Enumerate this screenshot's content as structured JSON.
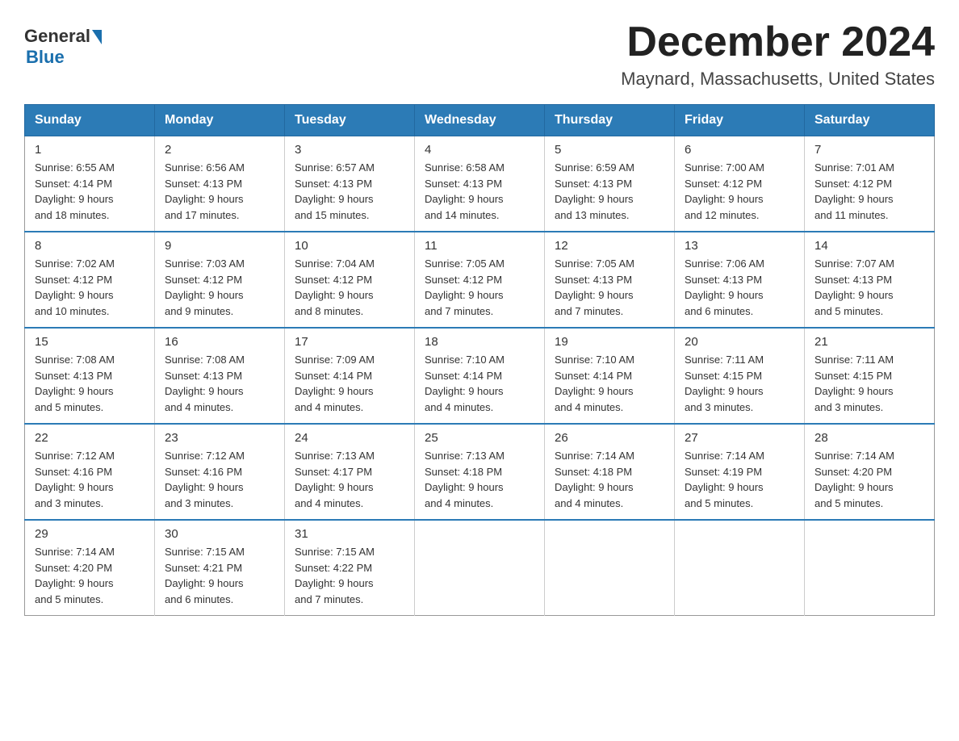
{
  "logo": {
    "general": "General",
    "blue": "Blue"
  },
  "title": {
    "month": "December 2024",
    "location": "Maynard, Massachusetts, United States"
  },
  "weekdays": [
    "Sunday",
    "Monday",
    "Tuesday",
    "Wednesday",
    "Thursday",
    "Friday",
    "Saturday"
  ],
  "weeks": [
    [
      {
        "day": "1",
        "sunrise": "6:55 AM",
        "sunset": "4:14 PM",
        "daylight": "9 hours and 18 minutes."
      },
      {
        "day": "2",
        "sunrise": "6:56 AM",
        "sunset": "4:13 PM",
        "daylight": "9 hours and 17 minutes."
      },
      {
        "day": "3",
        "sunrise": "6:57 AM",
        "sunset": "4:13 PM",
        "daylight": "9 hours and 15 minutes."
      },
      {
        "day": "4",
        "sunrise": "6:58 AM",
        "sunset": "4:13 PM",
        "daylight": "9 hours and 14 minutes."
      },
      {
        "day": "5",
        "sunrise": "6:59 AM",
        "sunset": "4:13 PM",
        "daylight": "9 hours and 13 minutes."
      },
      {
        "day": "6",
        "sunrise": "7:00 AM",
        "sunset": "4:12 PM",
        "daylight": "9 hours and 12 minutes."
      },
      {
        "day": "7",
        "sunrise": "7:01 AM",
        "sunset": "4:12 PM",
        "daylight": "9 hours and 11 minutes."
      }
    ],
    [
      {
        "day": "8",
        "sunrise": "7:02 AM",
        "sunset": "4:12 PM",
        "daylight": "9 hours and 10 minutes."
      },
      {
        "day": "9",
        "sunrise": "7:03 AM",
        "sunset": "4:12 PM",
        "daylight": "9 hours and 9 minutes."
      },
      {
        "day": "10",
        "sunrise": "7:04 AM",
        "sunset": "4:12 PM",
        "daylight": "9 hours and 8 minutes."
      },
      {
        "day": "11",
        "sunrise": "7:05 AM",
        "sunset": "4:12 PM",
        "daylight": "9 hours and 7 minutes."
      },
      {
        "day": "12",
        "sunrise": "7:05 AM",
        "sunset": "4:13 PM",
        "daylight": "9 hours and 7 minutes."
      },
      {
        "day": "13",
        "sunrise": "7:06 AM",
        "sunset": "4:13 PM",
        "daylight": "9 hours and 6 minutes."
      },
      {
        "day": "14",
        "sunrise": "7:07 AM",
        "sunset": "4:13 PM",
        "daylight": "9 hours and 5 minutes."
      }
    ],
    [
      {
        "day": "15",
        "sunrise": "7:08 AM",
        "sunset": "4:13 PM",
        "daylight": "9 hours and 5 minutes."
      },
      {
        "day": "16",
        "sunrise": "7:08 AM",
        "sunset": "4:13 PM",
        "daylight": "9 hours and 4 minutes."
      },
      {
        "day": "17",
        "sunrise": "7:09 AM",
        "sunset": "4:14 PM",
        "daylight": "9 hours and 4 minutes."
      },
      {
        "day": "18",
        "sunrise": "7:10 AM",
        "sunset": "4:14 PM",
        "daylight": "9 hours and 4 minutes."
      },
      {
        "day": "19",
        "sunrise": "7:10 AM",
        "sunset": "4:14 PM",
        "daylight": "9 hours and 4 minutes."
      },
      {
        "day": "20",
        "sunrise": "7:11 AM",
        "sunset": "4:15 PM",
        "daylight": "9 hours and 3 minutes."
      },
      {
        "day": "21",
        "sunrise": "7:11 AM",
        "sunset": "4:15 PM",
        "daylight": "9 hours and 3 minutes."
      }
    ],
    [
      {
        "day": "22",
        "sunrise": "7:12 AM",
        "sunset": "4:16 PM",
        "daylight": "9 hours and 3 minutes."
      },
      {
        "day": "23",
        "sunrise": "7:12 AM",
        "sunset": "4:16 PM",
        "daylight": "9 hours and 3 minutes."
      },
      {
        "day": "24",
        "sunrise": "7:13 AM",
        "sunset": "4:17 PM",
        "daylight": "9 hours and 4 minutes."
      },
      {
        "day": "25",
        "sunrise": "7:13 AM",
        "sunset": "4:18 PM",
        "daylight": "9 hours and 4 minutes."
      },
      {
        "day": "26",
        "sunrise": "7:14 AM",
        "sunset": "4:18 PM",
        "daylight": "9 hours and 4 minutes."
      },
      {
        "day": "27",
        "sunrise": "7:14 AM",
        "sunset": "4:19 PM",
        "daylight": "9 hours and 5 minutes."
      },
      {
        "day": "28",
        "sunrise": "7:14 AM",
        "sunset": "4:20 PM",
        "daylight": "9 hours and 5 minutes."
      }
    ],
    [
      {
        "day": "29",
        "sunrise": "7:14 AM",
        "sunset": "4:20 PM",
        "daylight": "9 hours and 5 minutes."
      },
      {
        "day": "30",
        "sunrise": "7:15 AM",
        "sunset": "4:21 PM",
        "daylight": "9 hours and 6 minutes."
      },
      {
        "day": "31",
        "sunrise": "7:15 AM",
        "sunset": "4:22 PM",
        "daylight": "9 hours and 7 minutes."
      },
      null,
      null,
      null,
      null
    ]
  ],
  "labels": {
    "sunrise": "Sunrise: ",
    "sunset": "Sunset: ",
    "daylight": "Daylight: "
  }
}
